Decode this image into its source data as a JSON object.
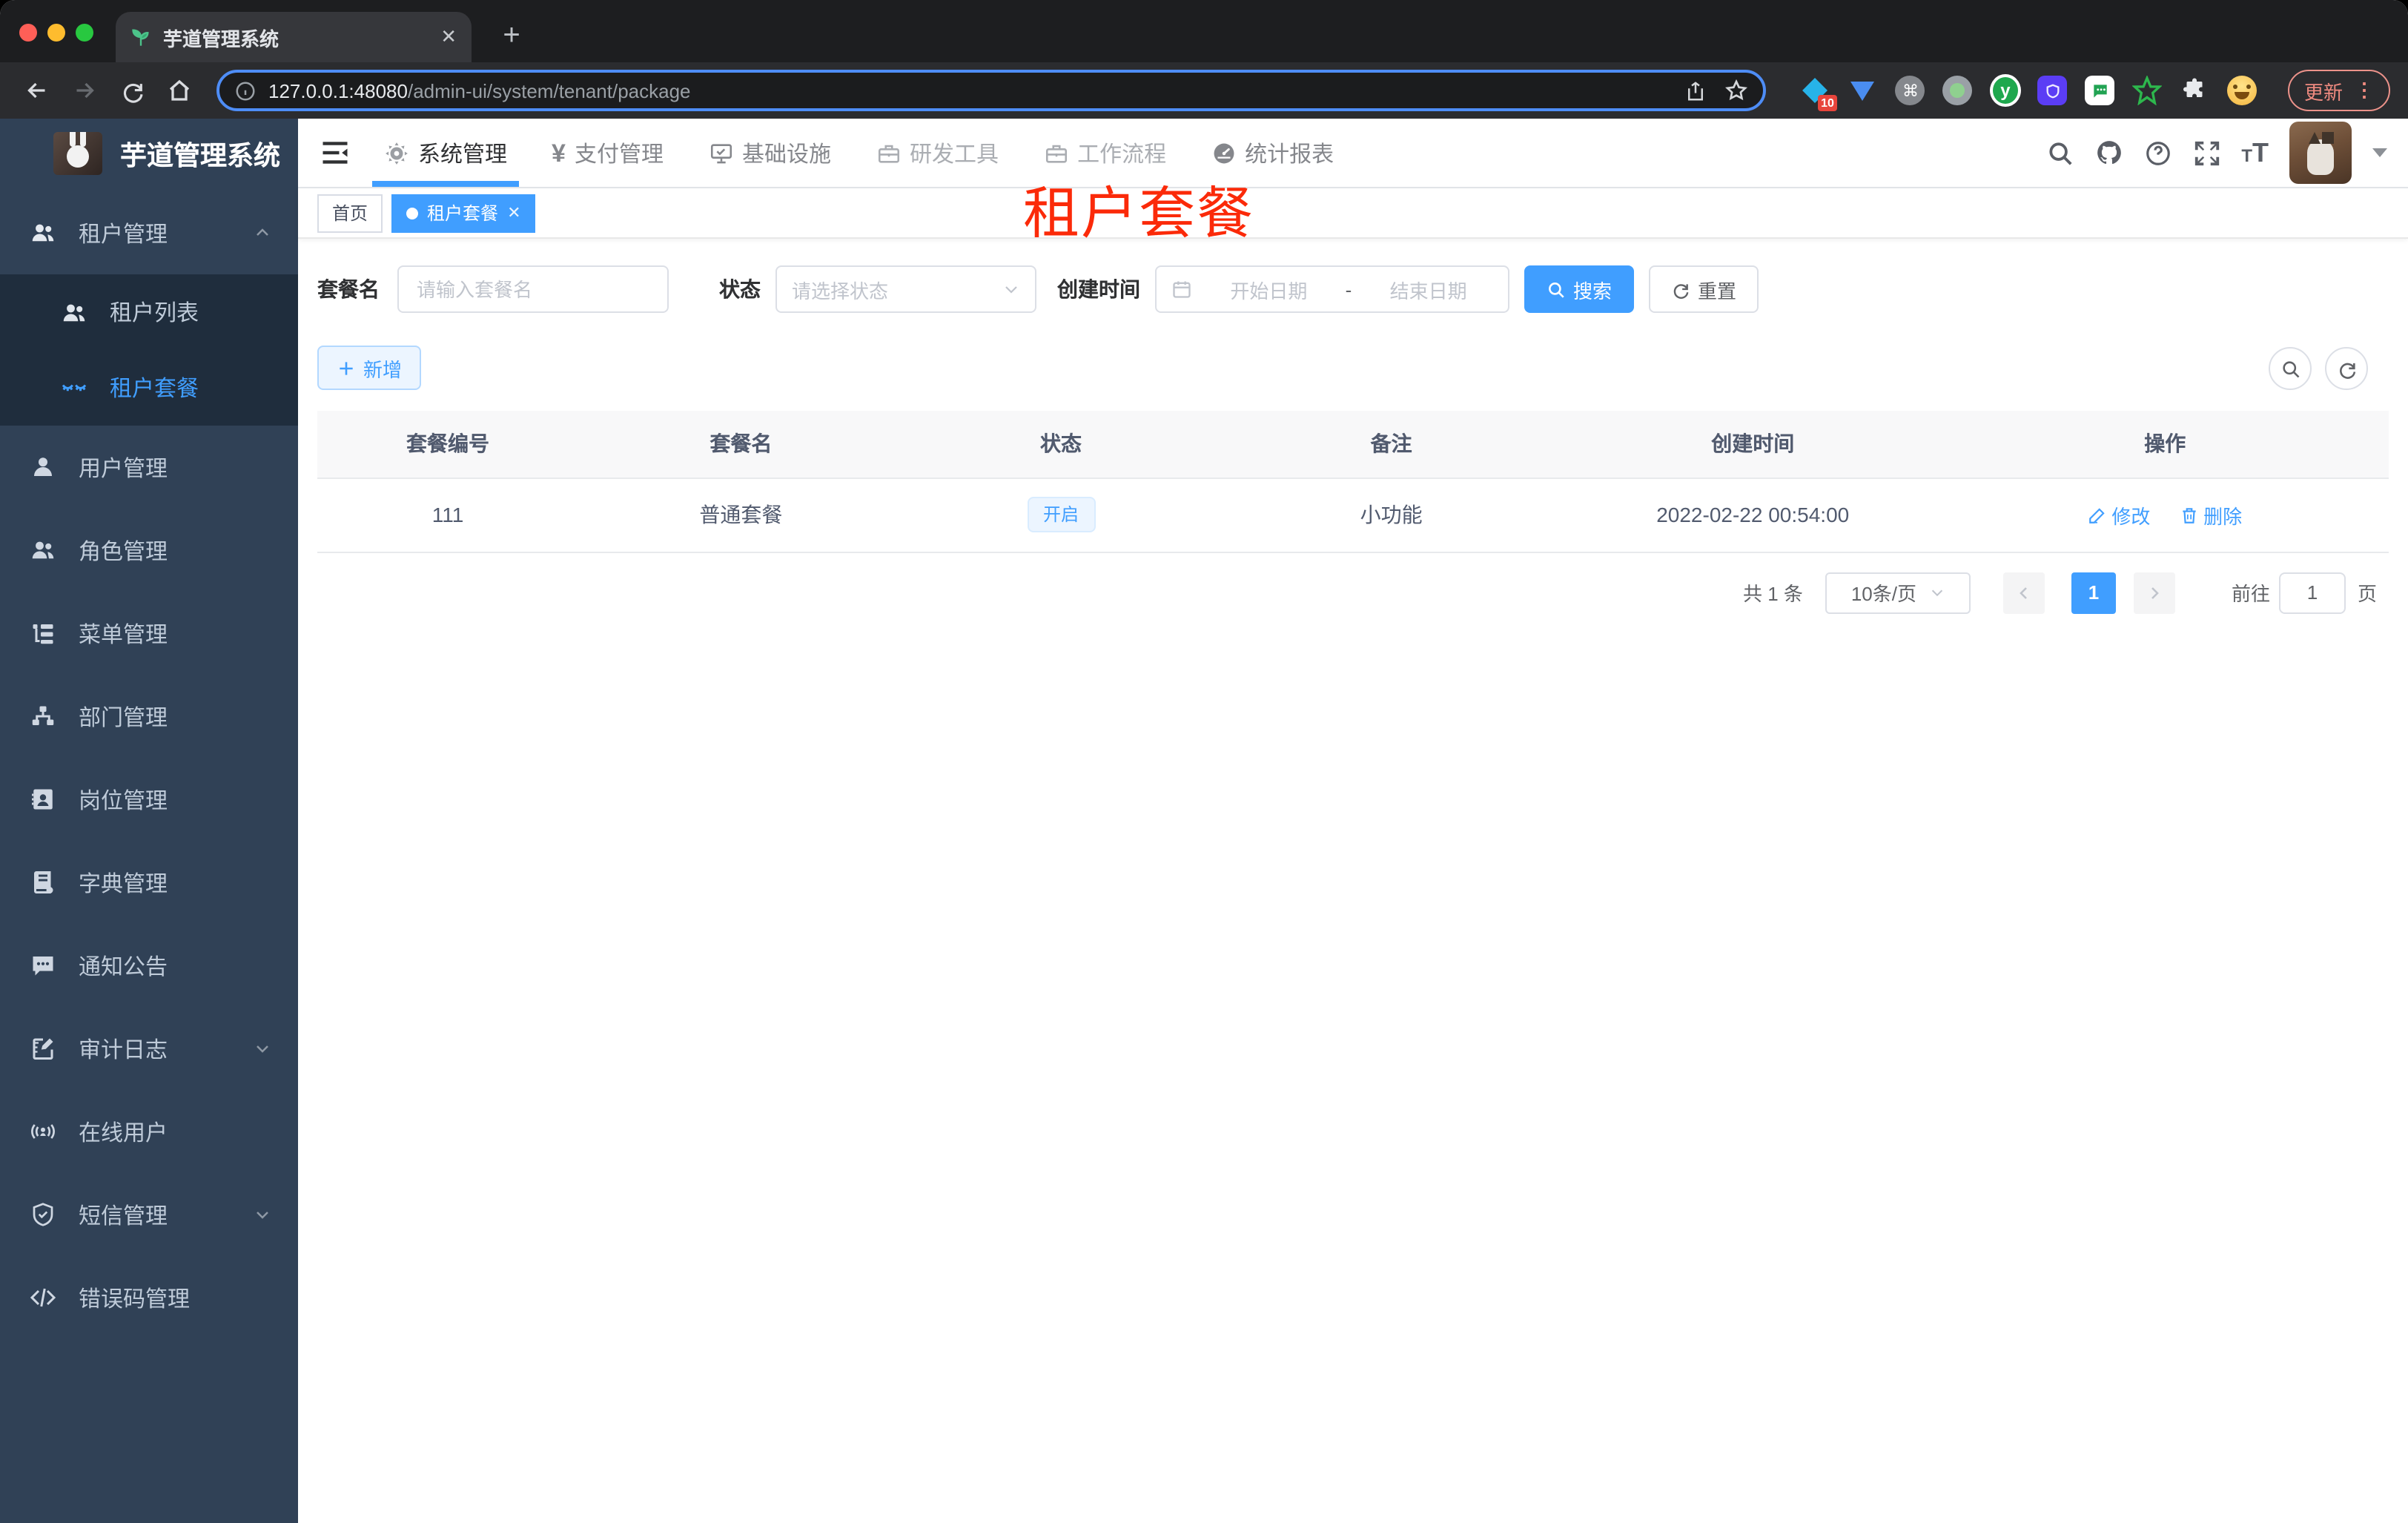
{
  "colors": {
    "accent": "#409eff",
    "annotation_red": "#fb2a09",
    "sidebar_bg": "#304156",
    "submenu_bg": "#1f2d3d"
  },
  "browser": {
    "tab_title": "芋道管理系统",
    "url_host": "127.0.0.1:48080",
    "url_path": "/admin-ui/system/tenant/package",
    "update_label": "更新",
    "extension_badge": "10"
  },
  "sidebar": {
    "app_title": "芋道管理系统",
    "items": [
      {
        "label": "租户管理"
      },
      {
        "label": "租户列表"
      },
      {
        "label": "租户套餐"
      },
      {
        "label": "用户管理"
      },
      {
        "label": "角色管理"
      },
      {
        "label": "菜单管理"
      },
      {
        "label": "部门管理"
      },
      {
        "label": "岗位管理"
      },
      {
        "label": "字典管理"
      },
      {
        "label": "通知公告"
      },
      {
        "label": "审计日志"
      },
      {
        "label": "在线用户"
      },
      {
        "label": "短信管理"
      },
      {
        "label": "错误码管理"
      }
    ]
  },
  "nav": {
    "items": [
      {
        "label": "系统管理"
      },
      {
        "label": "支付管理"
      },
      {
        "label": "基础设施"
      },
      {
        "label": "研发工具"
      },
      {
        "label": "工作流程"
      },
      {
        "label": "统计报表"
      }
    ]
  },
  "tags": {
    "home": "首页",
    "active": "租户套餐"
  },
  "annotation": "租户套餐",
  "form": {
    "package_name": {
      "label": "套餐名",
      "placeholder": "请输入套餐名"
    },
    "status": {
      "label": "状态",
      "placeholder": "请选择状态"
    },
    "create_time": {
      "label": "创建时间",
      "start_placeholder": "开始日期",
      "separator": "-",
      "end_placeholder": "结束日期"
    },
    "search_label": "搜索",
    "reset_label": "重置"
  },
  "toolbar": {
    "add_label": "新增"
  },
  "table": {
    "headers": [
      "套餐编号",
      "套餐名",
      "状态",
      "备注",
      "创建时间",
      "操作"
    ],
    "row": {
      "id": "111",
      "name": "普通套餐",
      "status": "开启",
      "remark": "小功能",
      "created": "2022-02-22 00:54:00",
      "edit_label": "修改",
      "delete_label": "删除"
    }
  },
  "pagination": {
    "total": "共 1 条",
    "page_size": "10条/页",
    "page": "1",
    "goto_label": "前往",
    "goto_value": "1",
    "unit_label": "页"
  }
}
